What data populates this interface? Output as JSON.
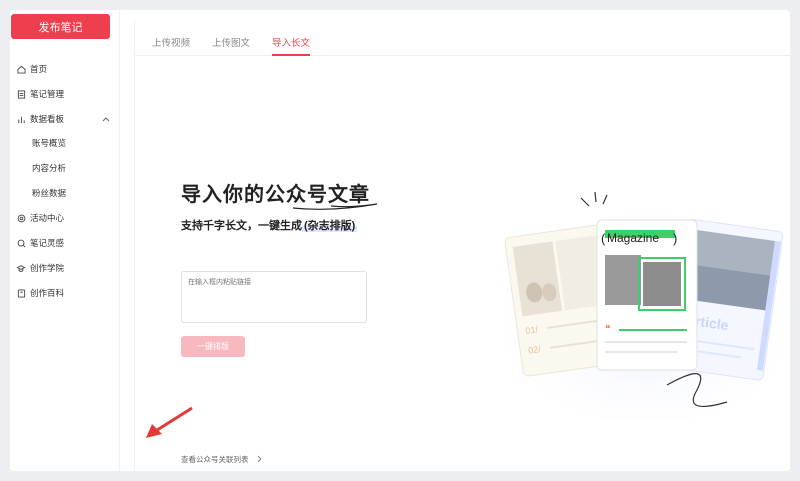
{
  "sidebar": {
    "publish_label": "发布笔记",
    "items": [
      {
        "label": "首页",
        "icon": "home-icon"
      },
      {
        "label": "笔记管理",
        "icon": "note-icon"
      },
      {
        "label": "数据看板",
        "icon": "chart-icon"
      },
      {
        "label": "账号概览"
      },
      {
        "label": "内容分析"
      },
      {
        "label": "粉丝数据"
      },
      {
        "label": "活动中心",
        "icon": "activity-icon"
      },
      {
        "label": "笔记灵感",
        "icon": "inspiration-icon"
      },
      {
        "label": "创作学院",
        "icon": "academy-icon"
      },
      {
        "label": "创作百科",
        "icon": "encyclopedia-icon"
      }
    ]
  },
  "tabs": [
    "上传视频",
    "上传图文",
    "导入长文"
  ],
  "active_tab": "导入长文",
  "hero": {
    "title": "导入你的公众号文章",
    "subtitle_prefix": "支持千字长文，一键生成",
    "subtitle_highlight": "(杂志排版)"
  },
  "input": {
    "placeholder": "在输入框内粘贴链接"
  },
  "layout_button": "一键排版",
  "footer_link": "查看公众号关联列表",
  "illustration": {
    "card_left_labels": [
      "01/",
      "02/"
    ],
    "card_middle_label": "Magazine",
    "card_right_label": "Article"
  },
  "colors": {
    "accent": "#ef3f4f",
    "accent_light": "#f7b9bf",
    "green": "#3ccf6a",
    "blue_light": "#dfe7ff"
  }
}
